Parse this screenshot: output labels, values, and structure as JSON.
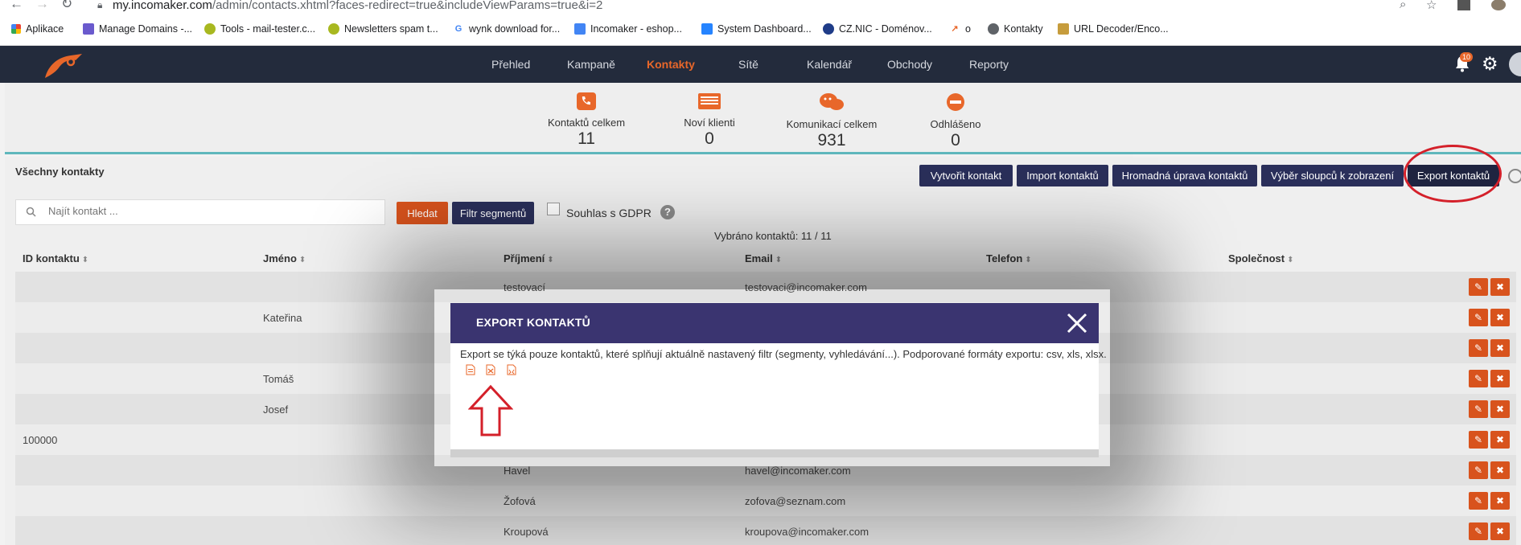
{
  "browser": {
    "url_host": "my.incomaker.com",
    "url_path": "/admin/contacts.xhtml?faces-redirect=true&includeViewParams=true&i=2",
    "bookmarks": [
      {
        "label": "Aplikace"
      },
      {
        "label": "Manage Domains -..."
      },
      {
        "label": "Tools - mail-tester.c..."
      },
      {
        "label": "Newsletters spam t..."
      },
      {
        "label": "wynk download for..."
      },
      {
        "label": "Incomaker - eshop..."
      },
      {
        "label": "System Dashboard..."
      },
      {
        "label": "CZ.NIC - Doménov..."
      },
      {
        "label": "o"
      },
      {
        "label": "Kontakty"
      },
      {
        "label": "URL Decoder/Enco..."
      }
    ]
  },
  "nav": {
    "items": [
      "Přehled",
      "Kampaně",
      "Kontakty",
      "Sítě",
      "Kalendář",
      "Obchody",
      "Reporty"
    ],
    "active": "Kontakty",
    "notification_count": "10"
  },
  "stats": [
    {
      "label": "Kontaktů celkem",
      "value": "11"
    },
    {
      "label": "Noví klienti",
      "value": "0"
    },
    {
      "label": "Komunikací celkem",
      "value": "931"
    },
    {
      "label": "Odhlášeno",
      "value": "0"
    }
  ],
  "toolbar": {
    "title": "Všechny kontakty",
    "create": "Vytvořit kontakt",
    "import": "Import kontaktů",
    "bulk_edit": "Hromadná úprava kontaktů",
    "columns": "Výběr sloupců k zobrazení",
    "export": "Export kontaktů"
  },
  "search": {
    "placeholder": "Najít kontakt ...",
    "search_button": "Hledat",
    "filter_button": "Filtr segmentů",
    "gdpr_label": "Souhlas s GDPR",
    "selected": "Vybráno kontaktů: 11 / 11"
  },
  "table": {
    "headers": [
      "ID kontaktu",
      "Jméno",
      "Příjmení",
      "Email",
      "Telefon",
      "Společnost"
    ],
    "rows": [
      {
        "id": "",
        "first": "",
        "last": "testovací",
        "email": "testovaci@incomaker.com"
      },
      {
        "id": "",
        "first": "Kateřina",
        "last": "",
        "email": ""
      },
      {
        "id": "",
        "first": "",
        "last": "",
        "email": ""
      },
      {
        "id": "",
        "first": "Tomáš",
        "last": "",
        "email": ""
      },
      {
        "id": "",
        "first": "Josef",
        "last": "",
        "email": ""
      },
      {
        "id": "100000",
        "first": "",
        "last": "",
        "email": ""
      },
      {
        "id": "",
        "first": "",
        "last": "Havel",
        "email": "havel@incomaker.com"
      },
      {
        "id": "",
        "first": "",
        "last": "Žofová",
        "email": "zofova@seznam.com"
      },
      {
        "id": "",
        "first": "",
        "last": "Kroupová",
        "email": "kroupova@incomaker.com"
      }
    ]
  },
  "modal": {
    "title": "EXPORT KONTAKTŮ",
    "text": "Export se týká pouze kontaktů, které splňují aktuálně nastavený filtr (segmenty, vyhledávání...). Podporované formáty exportu: csv, xls, xlsx.",
    "formats": [
      "csv",
      "xls",
      "xlsx"
    ]
  },
  "colors": {
    "accent": "#e8672a",
    "header_bg": "#232b3c",
    "button_dark": "#2a2f5a",
    "modal_header": "#3a3470",
    "annotation_red": "#d4202a"
  }
}
